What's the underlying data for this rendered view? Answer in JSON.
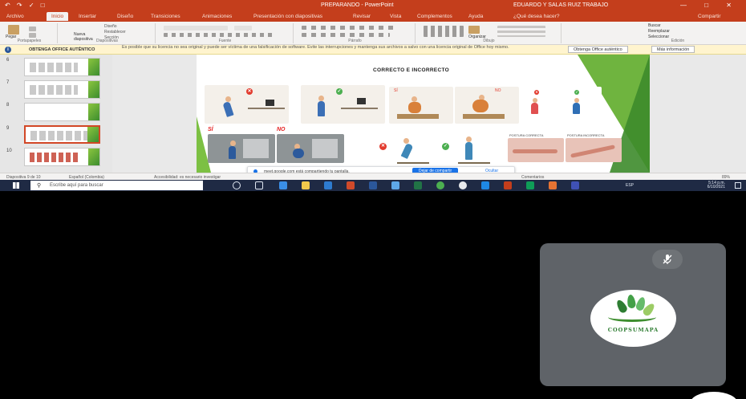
{
  "window": {
    "title": "PREPARANDO - PowerPoint",
    "user": "EDUARDO Y SALAS RUIZ TRABAJO",
    "quick_access": "↶ ↷ ✓ □",
    "controls": "— □ ✕"
  },
  "ribbon_tabs": [
    "Archivo",
    "Inicio",
    "Insertar",
    "Diseño",
    "Transiciones",
    "Animaciones",
    "Presentación con diapositivas",
    "Revisar",
    "Vista",
    "Complementos",
    "Ayuda",
    "¿Qué desea hacer?",
    "Compartir"
  ],
  "ribbon_groups": [
    "Portapapeles",
    "Diapositivas",
    "Fuente",
    "Párrafo",
    "Dibujo",
    "Edición"
  ],
  "ribbon_buttons": {
    "paste": "Pegar",
    "new_slide": "Nueva diapositiva",
    "layout": "Diseño",
    "reset": "Restablecer",
    "section": "Sección",
    "arrange": "Organizar",
    "find": "Buscar",
    "replace": "Reemplazar",
    "select": "Seleccionar"
  },
  "message_bar": {
    "heading": "OBTENGA OFFICE AUTÉNTICO",
    "body": "Es posible que su licencia no sea original y puede ser víctima de una falsificación de software. Evite las interrupciones y mantenga sus archivos a salvo con una licencia original de Office hoy mismo.",
    "primary_button": "Obtenga Office auténtico",
    "secondary_button": "Más información"
  },
  "thumbnails": [
    {
      "number": "6",
      "selected": false
    },
    {
      "number": "7",
      "selected": false
    },
    {
      "number": "8",
      "selected": false
    },
    {
      "number": "9",
      "selected": true
    },
    {
      "number": "10",
      "selected": false
    }
  ],
  "slide": {
    "title": "CORRECTO E INCORRECTO",
    "yes_label": "SÍ",
    "no_label": "NO",
    "caption_correct": "POSTURA CORRECTA",
    "caption_incorrect": "POSTURA INCORRECTA"
  },
  "share_bar": {
    "message": "meet.google.com está compartiendo tu pantalla.",
    "stop_button": "Dejar de compartir",
    "hide_button": "Ocultar"
  },
  "status_bar": {
    "slide_info": "Diapositiva 9 de 10",
    "language": "Español (Colombia)",
    "accessibility": "Accesibilidad: es necesario investigar",
    "comments": "Comentarios",
    "zoom": "89%"
  },
  "taskbar": {
    "search_placeholder": "Escribe aquí para buscar",
    "time": "5:14 p.m.",
    "date": "6/10/2021",
    "language": "ESP"
  },
  "participant": {
    "name": "COOPSUMAPA",
    "mic_muted": true
  },
  "colors": {
    "ppt_red": "#c43e1c",
    "accent_green": "#6fb43f",
    "meet_blue": "#1a73e8",
    "tile_gray": "#5f6368"
  }
}
